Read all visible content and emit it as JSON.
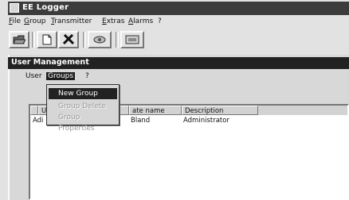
{
  "app": {
    "title": "EE Logger"
  },
  "menubar": {
    "items": [
      "File",
      "Group",
      "Transmitter",
      "Extras",
      "Alarms",
      "?"
    ]
  },
  "toolbar": {
    "buttons": [
      "open-folder-icon",
      "new-document-icon",
      "delete-icon",
      "view-icon",
      "screen-icon"
    ]
  },
  "child_window": {
    "title": "User Management",
    "menu": {
      "items": [
        "User",
        "Groups",
        "?"
      ],
      "active": "Groups"
    }
  },
  "groups_menu": {
    "items": [
      {
        "label": "New Group",
        "state": "selected"
      },
      {
        "label": "Group Delete",
        "state": "disabled"
      },
      {
        "label": "Group Properties",
        "state": "disabled"
      }
    ]
  },
  "user_list": {
    "columns": [
      "Us",
      "ate name",
      "Description"
    ],
    "rows": [
      [
        "Adi",
        "Bland",
        "Administrator"
      ]
    ]
  }
}
